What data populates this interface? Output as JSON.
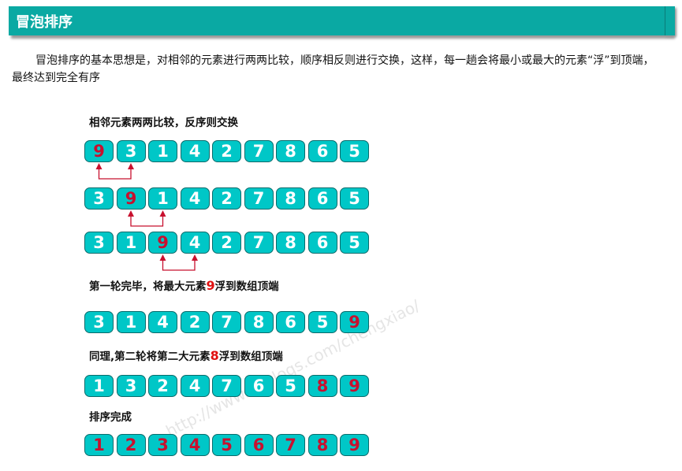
{
  "header": {
    "title": "冒泡排序"
  },
  "intro": "冒泡排序的基本思想是，对相邻的元素进行两两比较，顺序相反则进行交换，这样，每一趟会将最小或最大的元素“浮”到顶端，最终达到完全有序",
  "captions": {
    "c1": "相邻元素两两比较，反序则交换",
    "c2_pre": "第一轮完毕，将最大元素",
    "c2_num": "9",
    "c2_post": "浮到数组顶端",
    "c3_pre": "同理,第二轮将第二大元素",
    "c3_num": "8",
    "c3_post": "浮到数组顶端",
    "c4": "排序完成"
  },
  "watermark": "http://www.cnblogs.com/chengxiao/",
  "rows": [
    [
      {
        "v": "9",
        "red": true
      },
      {
        "v": "3"
      },
      {
        "v": "1"
      },
      {
        "v": "4"
      },
      {
        "v": "2"
      },
      {
        "v": "7"
      },
      {
        "v": "8"
      },
      {
        "v": "6"
      },
      {
        "v": "5"
      }
    ],
    [
      {
        "v": "3"
      },
      {
        "v": "9",
        "red": true
      },
      {
        "v": "1"
      },
      {
        "v": "4"
      },
      {
        "v": "2"
      },
      {
        "v": "7"
      },
      {
        "v": "8"
      },
      {
        "v": "6"
      },
      {
        "v": "5"
      }
    ],
    [
      {
        "v": "3"
      },
      {
        "v": "1"
      },
      {
        "v": "9",
        "red": true
      },
      {
        "v": "4"
      },
      {
        "v": "2"
      },
      {
        "v": "7"
      },
      {
        "v": "8"
      },
      {
        "v": "6"
      },
      {
        "v": "5"
      }
    ],
    [
      {
        "v": "3"
      },
      {
        "v": "1"
      },
      {
        "v": "4"
      },
      {
        "v": "2"
      },
      {
        "v": "7"
      },
      {
        "v": "8"
      },
      {
        "v": "6"
      },
      {
        "v": "5"
      },
      {
        "v": "9",
        "red": true
      }
    ],
    [
      {
        "v": "1"
      },
      {
        "v": "3"
      },
      {
        "v": "2"
      },
      {
        "v": "4"
      },
      {
        "v": "7"
      },
      {
        "v": "6"
      },
      {
        "v": "5"
      },
      {
        "v": "8",
        "red": true
      },
      {
        "v": "9",
        "red": true
      }
    ],
    [
      {
        "v": "1",
        "red": true
      },
      {
        "v": "2",
        "red": true
      },
      {
        "v": "3",
        "red": true
      },
      {
        "v": "4",
        "red": true
      },
      {
        "v": "5",
        "red": true
      },
      {
        "v": "6",
        "red": true
      },
      {
        "v": "7",
        "red": true
      },
      {
        "v": "8",
        "red": true
      },
      {
        "v": "9",
        "red": true
      }
    ]
  ],
  "swap_arrows": [
    {
      "row": 0,
      "from": 0,
      "to": 1
    },
    {
      "row": 1,
      "from": 1,
      "to": 2
    },
    {
      "row": 2,
      "from": 2,
      "to": 3
    }
  ],
  "colors": {
    "header": "#0aa9a3",
    "cell": "#00c7c7",
    "highlight": "#c8102e",
    "arrow": "#c8102e"
  }
}
